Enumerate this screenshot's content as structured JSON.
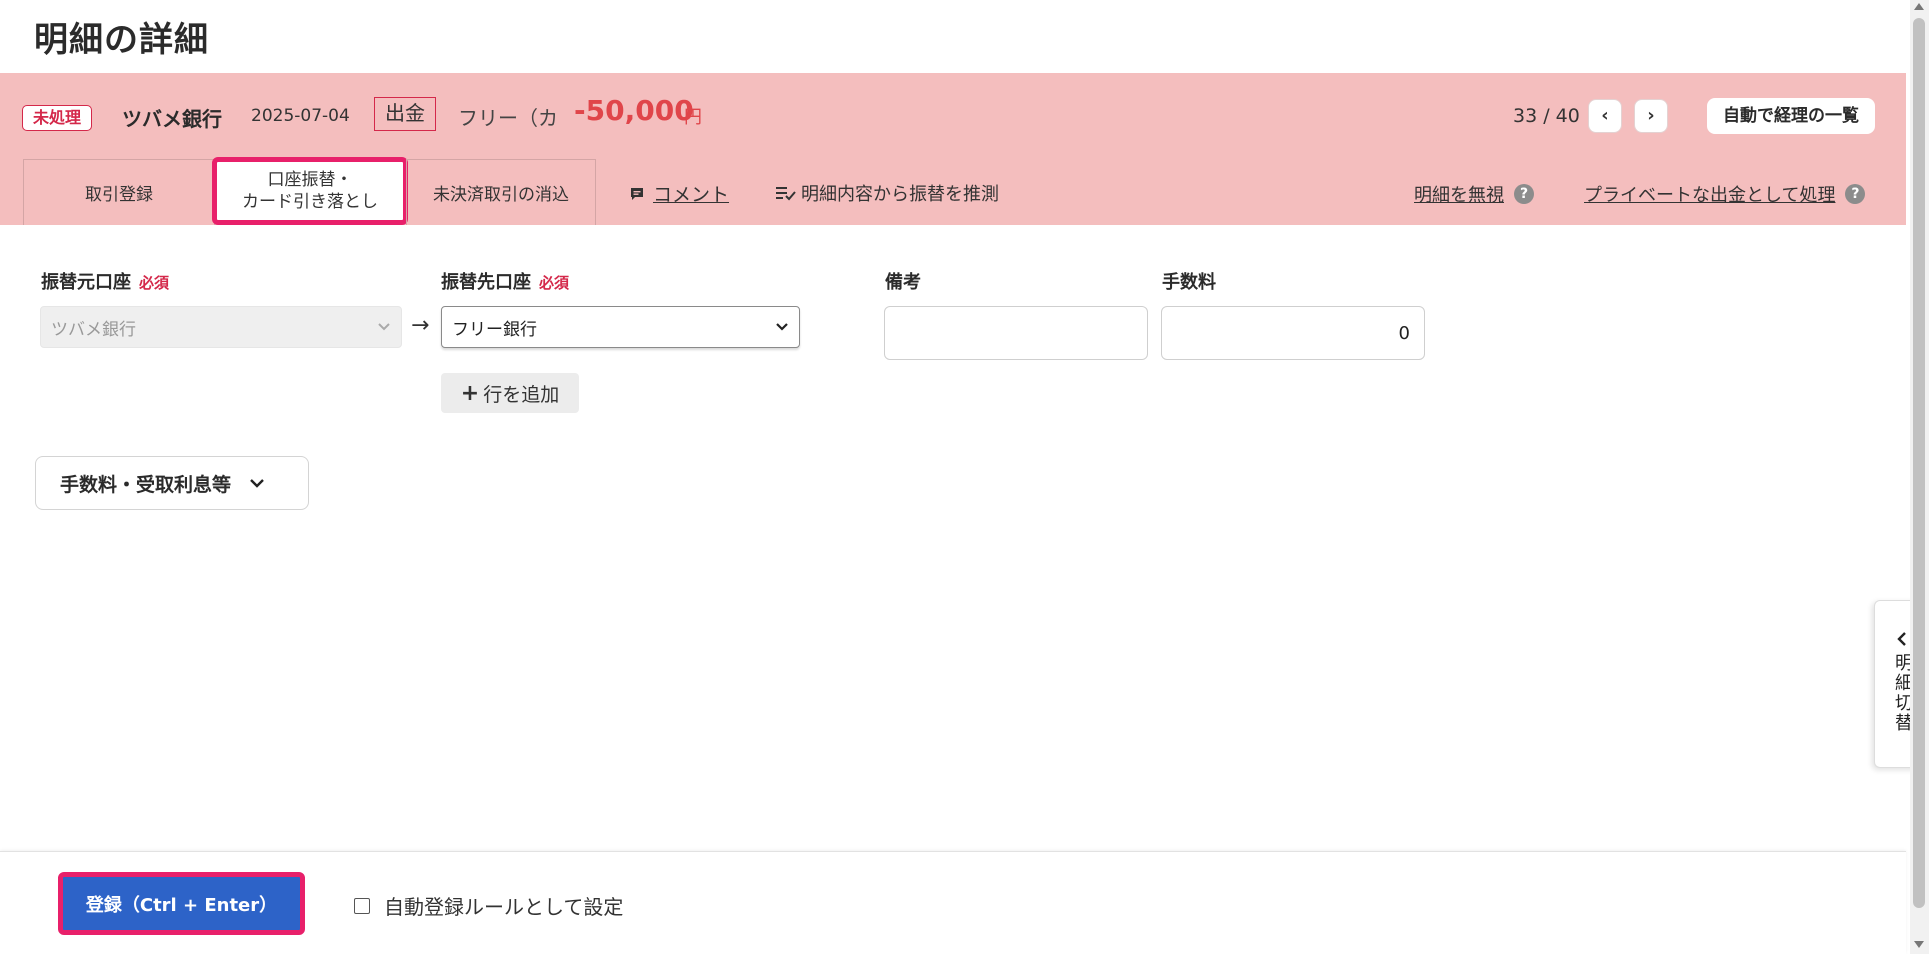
{
  "page": {
    "title": "明細の詳細"
  },
  "transaction": {
    "status": "未処理",
    "bank": "ツバメ銀行",
    "date": "2025-07-04",
    "direction": "出金",
    "partner": "フリー（カ",
    "amount": "-50,000",
    "currency_unit": "円"
  },
  "pager": {
    "position": "33 / 40",
    "prev": "‹",
    "next": "›"
  },
  "header_buttons": {
    "auto_list": "自動で経理の一覧"
  },
  "tabs": [
    {
      "label": "取引登録"
    },
    {
      "label_line1": "口座振替・",
      "label_line2": "カード引き落とし"
    },
    {
      "label": "未決済取引の消込"
    }
  ],
  "links": {
    "comment": "コメント",
    "guess_transfer": "明細内容から振替を推測",
    "ignore": "明細を無視",
    "private": "プライベートな出金として処理",
    "help_glyph": "?"
  },
  "form": {
    "from_label": "振替元口座",
    "to_label": "振替先口座",
    "required": "必須",
    "note_label": "備考",
    "fee_label": "手数料",
    "from_value": "ツバメ銀行",
    "to_value": "フリー銀行",
    "note_value": "",
    "fee_value": "0",
    "add_row": "行を追加"
  },
  "fee_section": {
    "label": "手数料・受取利息等"
  },
  "side_tab": {
    "label": "明細切替"
  },
  "footer": {
    "submit": "登録（Ctrl + Enter）",
    "auto_rule": "自動登録ルールとして設定"
  },
  "colors": {
    "accent_red": "#d4284a",
    "panel_pink": "#f4bebe",
    "primary_blue": "#2d63c8",
    "highlight": "#e8206a"
  }
}
